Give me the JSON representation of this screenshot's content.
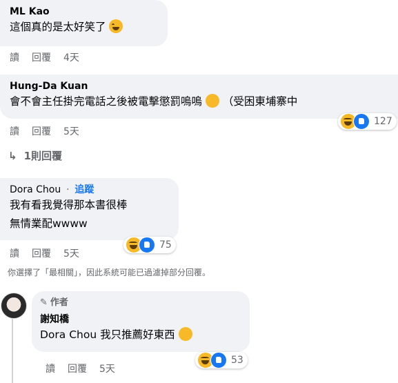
{
  "comments": [
    {
      "author": "ML Kao",
      "lines": [
        "這個真的是太好笑了"
      ],
      "actions": {
        "read": "讀",
        "reply": "回覆",
        "time": "4天"
      }
    },
    {
      "author": "Hung-Da Kuan",
      "lines": [
        "會不會主任掛完電話之後被電擊懲罰嗚嗚",
        "（受困東埔寨中"
      ],
      "actions": {
        "read": "讀",
        "reply": "回覆",
        "time": "5天"
      },
      "reaction_count": "127",
      "replies_link": "1則回覆"
    },
    {
      "author": "Dora Chou",
      "author_sep": "·",
      "follow": "追蹤",
      "lines": [
        "我有看我覺得那本書很棒",
        "無情業配wwww"
      ],
      "actions": {
        "read": "讀",
        "reply": "回覆",
        "time": "5天"
      },
      "reaction_count": "75"
    }
  ],
  "filter_note": "你選擇了「最相關」，因此系統可能已過濾掉部分回覆。",
  "author_reply": {
    "badge": "作者",
    "author": "謝知橋",
    "mention": "Dora Chou",
    "text": "我只推薦好東西",
    "actions": {
      "read": "讀",
      "reply": "回覆",
      "time": "5天"
    },
    "reaction_count": "53"
  },
  "colors": {
    "bubble": "#f0f2f5",
    "link": "#1877f2",
    "meta": "#65676b"
  }
}
